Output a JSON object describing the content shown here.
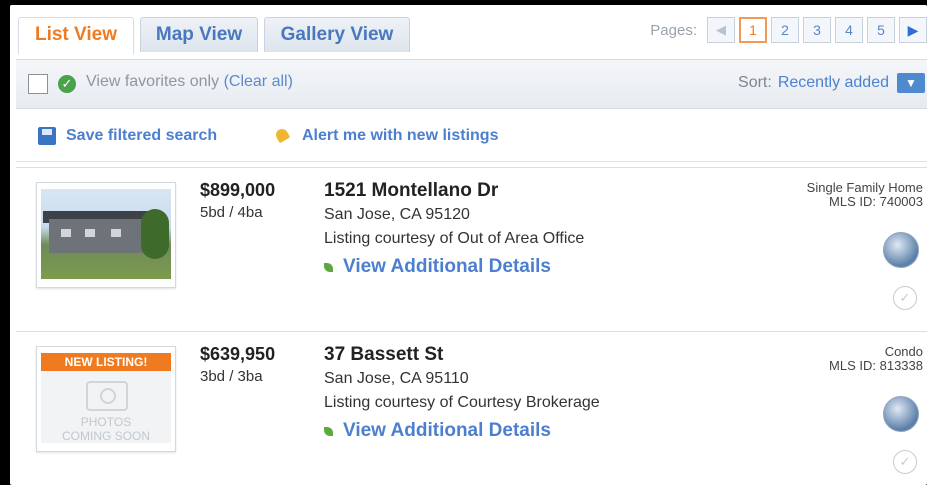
{
  "tabs": [
    {
      "label": "List View",
      "active": true
    },
    {
      "label": "Map View",
      "active": false
    },
    {
      "label": "Gallery View",
      "active": false
    }
  ],
  "pager": {
    "label": "Pages:",
    "prev": "◀",
    "pages": [
      "1",
      "2",
      "3",
      "4",
      "5"
    ],
    "current": "1",
    "next": "▶"
  },
  "filter": {
    "favorites_text": "View favorites only",
    "clear_all": "(Clear all)",
    "sort_label": "Sort:",
    "sort_value": "Recently added"
  },
  "actions": {
    "save_search": "Save filtered search",
    "alert": "Alert me with new listings"
  },
  "listings": [
    {
      "price": "$899,000",
      "beds_baths": "5bd / 4ba",
      "address": "1521 Montellano Dr",
      "city": "San Jose, CA  95120",
      "courtesy": "Listing courtesy of Out of Area Office",
      "details_link": "View Additional Details",
      "property_type": "Single Family Home",
      "mls_id": "MLS ID: 740003",
      "photo": "house-photo"
    },
    {
      "price": "$639,950",
      "beds_baths": "3bd / 3ba",
      "address": "37 Bassett St",
      "city": "San Jose, CA  95110",
      "courtesy": "Listing courtesy of Courtesy Brokerage",
      "details_link": "View Additional Details",
      "property_type": "Condo",
      "mls_id": "MLS ID: 813338",
      "new_badge": "NEW LISTING!",
      "photo_placeholder": [
        "PHOTOS",
        "COMING SOON"
      ]
    }
  ],
  "colors": {
    "accent_orange": "#f07a1f",
    "link_blue": "#4c7fcf"
  }
}
